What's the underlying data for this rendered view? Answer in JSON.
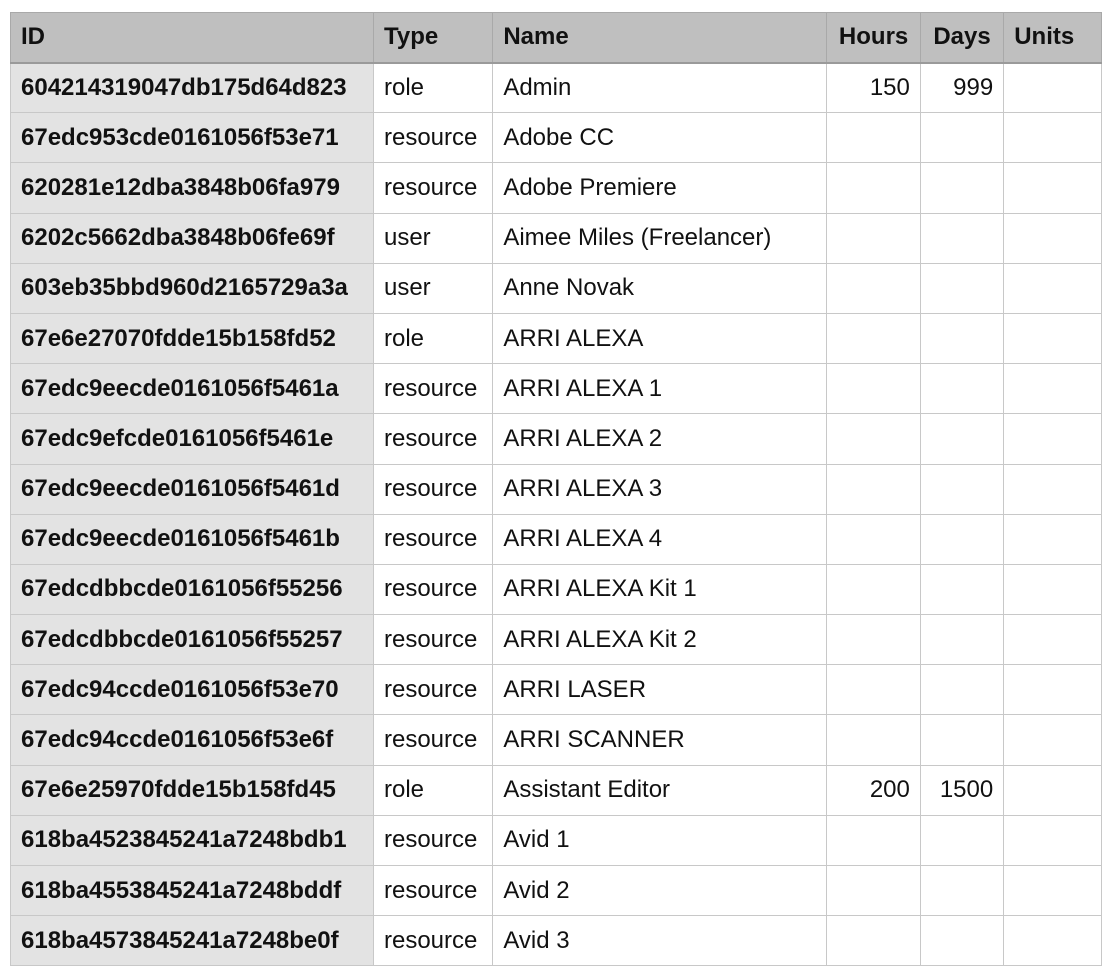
{
  "colors": {
    "header_bg": "#bfbfbf",
    "id_column_bg": "#e3e3e3",
    "grid_line": "#c8c8c8",
    "text": "#111111"
  },
  "table": {
    "columns": [
      "ID",
      "Type",
      "Name",
      "Hours",
      "Days",
      "Units"
    ],
    "rows": [
      {
        "id": "604214319047db175d64d823",
        "type": "role",
        "name": "Admin",
        "hours": "150",
        "days": "999",
        "units": ""
      },
      {
        "id": "67edc953cde0161056f53e71",
        "type": "resource",
        "name": "Adobe CC",
        "hours": "",
        "days": "",
        "units": ""
      },
      {
        "id": "620281e12dba3848b06fa979",
        "type": "resource",
        "name": "Adobe Premiere",
        "hours": "",
        "days": "",
        "units": ""
      },
      {
        "id": "6202c5662dba3848b06fe69f",
        "type": "user",
        "name": "Aimee Miles (Freelancer)",
        "hours": "",
        "days": "",
        "units": ""
      },
      {
        "id": "603eb35bbd960d2165729a3a",
        "type": "user",
        "name": "Anne Novak",
        "hours": "",
        "days": "",
        "units": ""
      },
      {
        "id": "67e6e27070fdde15b158fd52",
        "type": "role",
        "name": "ARRI ALEXA",
        "hours": "",
        "days": "",
        "units": ""
      },
      {
        "id": "67edc9eecde0161056f5461a",
        "type": "resource",
        "name": "ARRI ALEXA 1",
        "hours": "",
        "days": "",
        "units": ""
      },
      {
        "id": "67edc9efcde0161056f5461e",
        "type": "resource",
        "name": "ARRI ALEXA 2",
        "hours": "",
        "days": "",
        "units": ""
      },
      {
        "id": "67edc9eecde0161056f5461d",
        "type": "resource",
        "name": "ARRI ALEXA 3",
        "hours": "",
        "days": "",
        "units": ""
      },
      {
        "id": "67edc9eecde0161056f5461b",
        "type": "resource",
        "name": "ARRI ALEXA 4",
        "hours": "",
        "days": "",
        "units": ""
      },
      {
        "id": "67edcdbbcde0161056f55256",
        "type": "resource",
        "name": "ARRI ALEXA Kit 1",
        "hours": "",
        "days": "",
        "units": ""
      },
      {
        "id": "67edcdbbcde0161056f55257",
        "type": "resource",
        "name": "ARRI ALEXA Kit 2",
        "hours": "",
        "days": "",
        "units": ""
      },
      {
        "id": "67edc94ccde0161056f53e70",
        "type": "resource",
        "name": "ARRI LASER",
        "hours": "",
        "days": "",
        "units": ""
      },
      {
        "id": "67edc94ccde0161056f53e6f",
        "type": "resource",
        "name": "ARRI SCANNER",
        "hours": "",
        "days": "",
        "units": ""
      },
      {
        "id": "67e6e25970fdde15b158fd45",
        "type": "role",
        "name": "Assistant Editor",
        "hours": "200",
        "days": "1500",
        "units": ""
      },
      {
        "id": "618ba4523845241a7248bdb1",
        "type": "resource",
        "name": "Avid 1",
        "hours": "",
        "days": "",
        "units": ""
      },
      {
        "id": "618ba4553845241a7248bddf",
        "type": "resource",
        "name": "Avid 2",
        "hours": "",
        "days": "",
        "units": ""
      },
      {
        "id": "618ba4573845241a7248be0f",
        "type": "resource",
        "name": "Avid 3",
        "hours": "",
        "days": "",
        "units": ""
      }
    ]
  }
}
